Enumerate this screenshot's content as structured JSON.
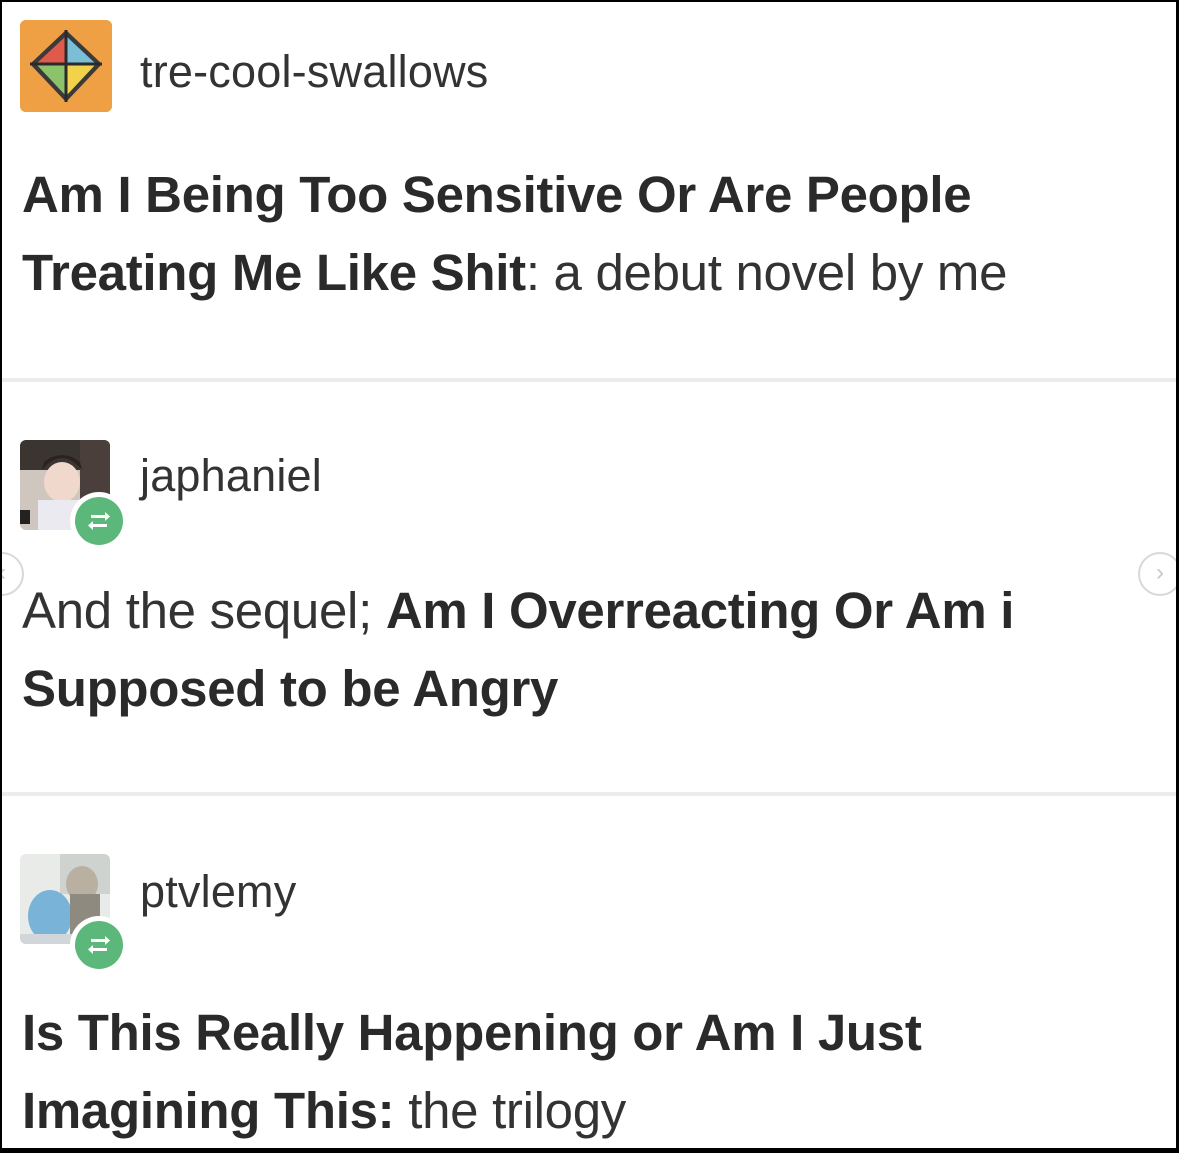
{
  "posts": [
    {
      "username": "tre-cool-swallows",
      "avatar_icon": "orange-diamond-avatar-icon",
      "segments": [
        {
          "text": "Am I Being Too Sensitive Or Are People Treating Me Like Shit",
          "bold": true
        },
        {
          "text": ": a debut novel by me",
          "bold": false
        }
      ]
    },
    {
      "username": "japhaniel",
      "avatar_icon": "person-photo-avatar-icon",
      "badge_icon": "reblog-icon",
      "segments": [
        {
          "text": "And the sequel; ",
          "bold": false
        },
        {
          "text": "Am I Overreacting Or Am i Supposed to be Angry",
          "bold": true
        }
      ]
    },
    {
      "username": "ptvlemy",
      "avatar_icon": "photo-avatar-icon",
      "badge_icon": "reblog-icon",
      "segments": [
        {
          "text": "Is This Really Happening or Am I Just Imagining This:",
          "bold": true
        },
        {
          "text": " the trilogy",
          "bold": false
        }
      ]
    }
  ],
  "nav": {
    "prev_icon": "chevron-left-icon",
    "next_icon": "chevron-right-icon",
    "prev_glyph": "‹",
    "next_glyph": "›"
  },
  "colors": {
    "text": "#333333",
    "reblog_green": "#5cb87a",
    "avatar_orange": "#f0a044",
    "divider": "#ececec"
  }
}
